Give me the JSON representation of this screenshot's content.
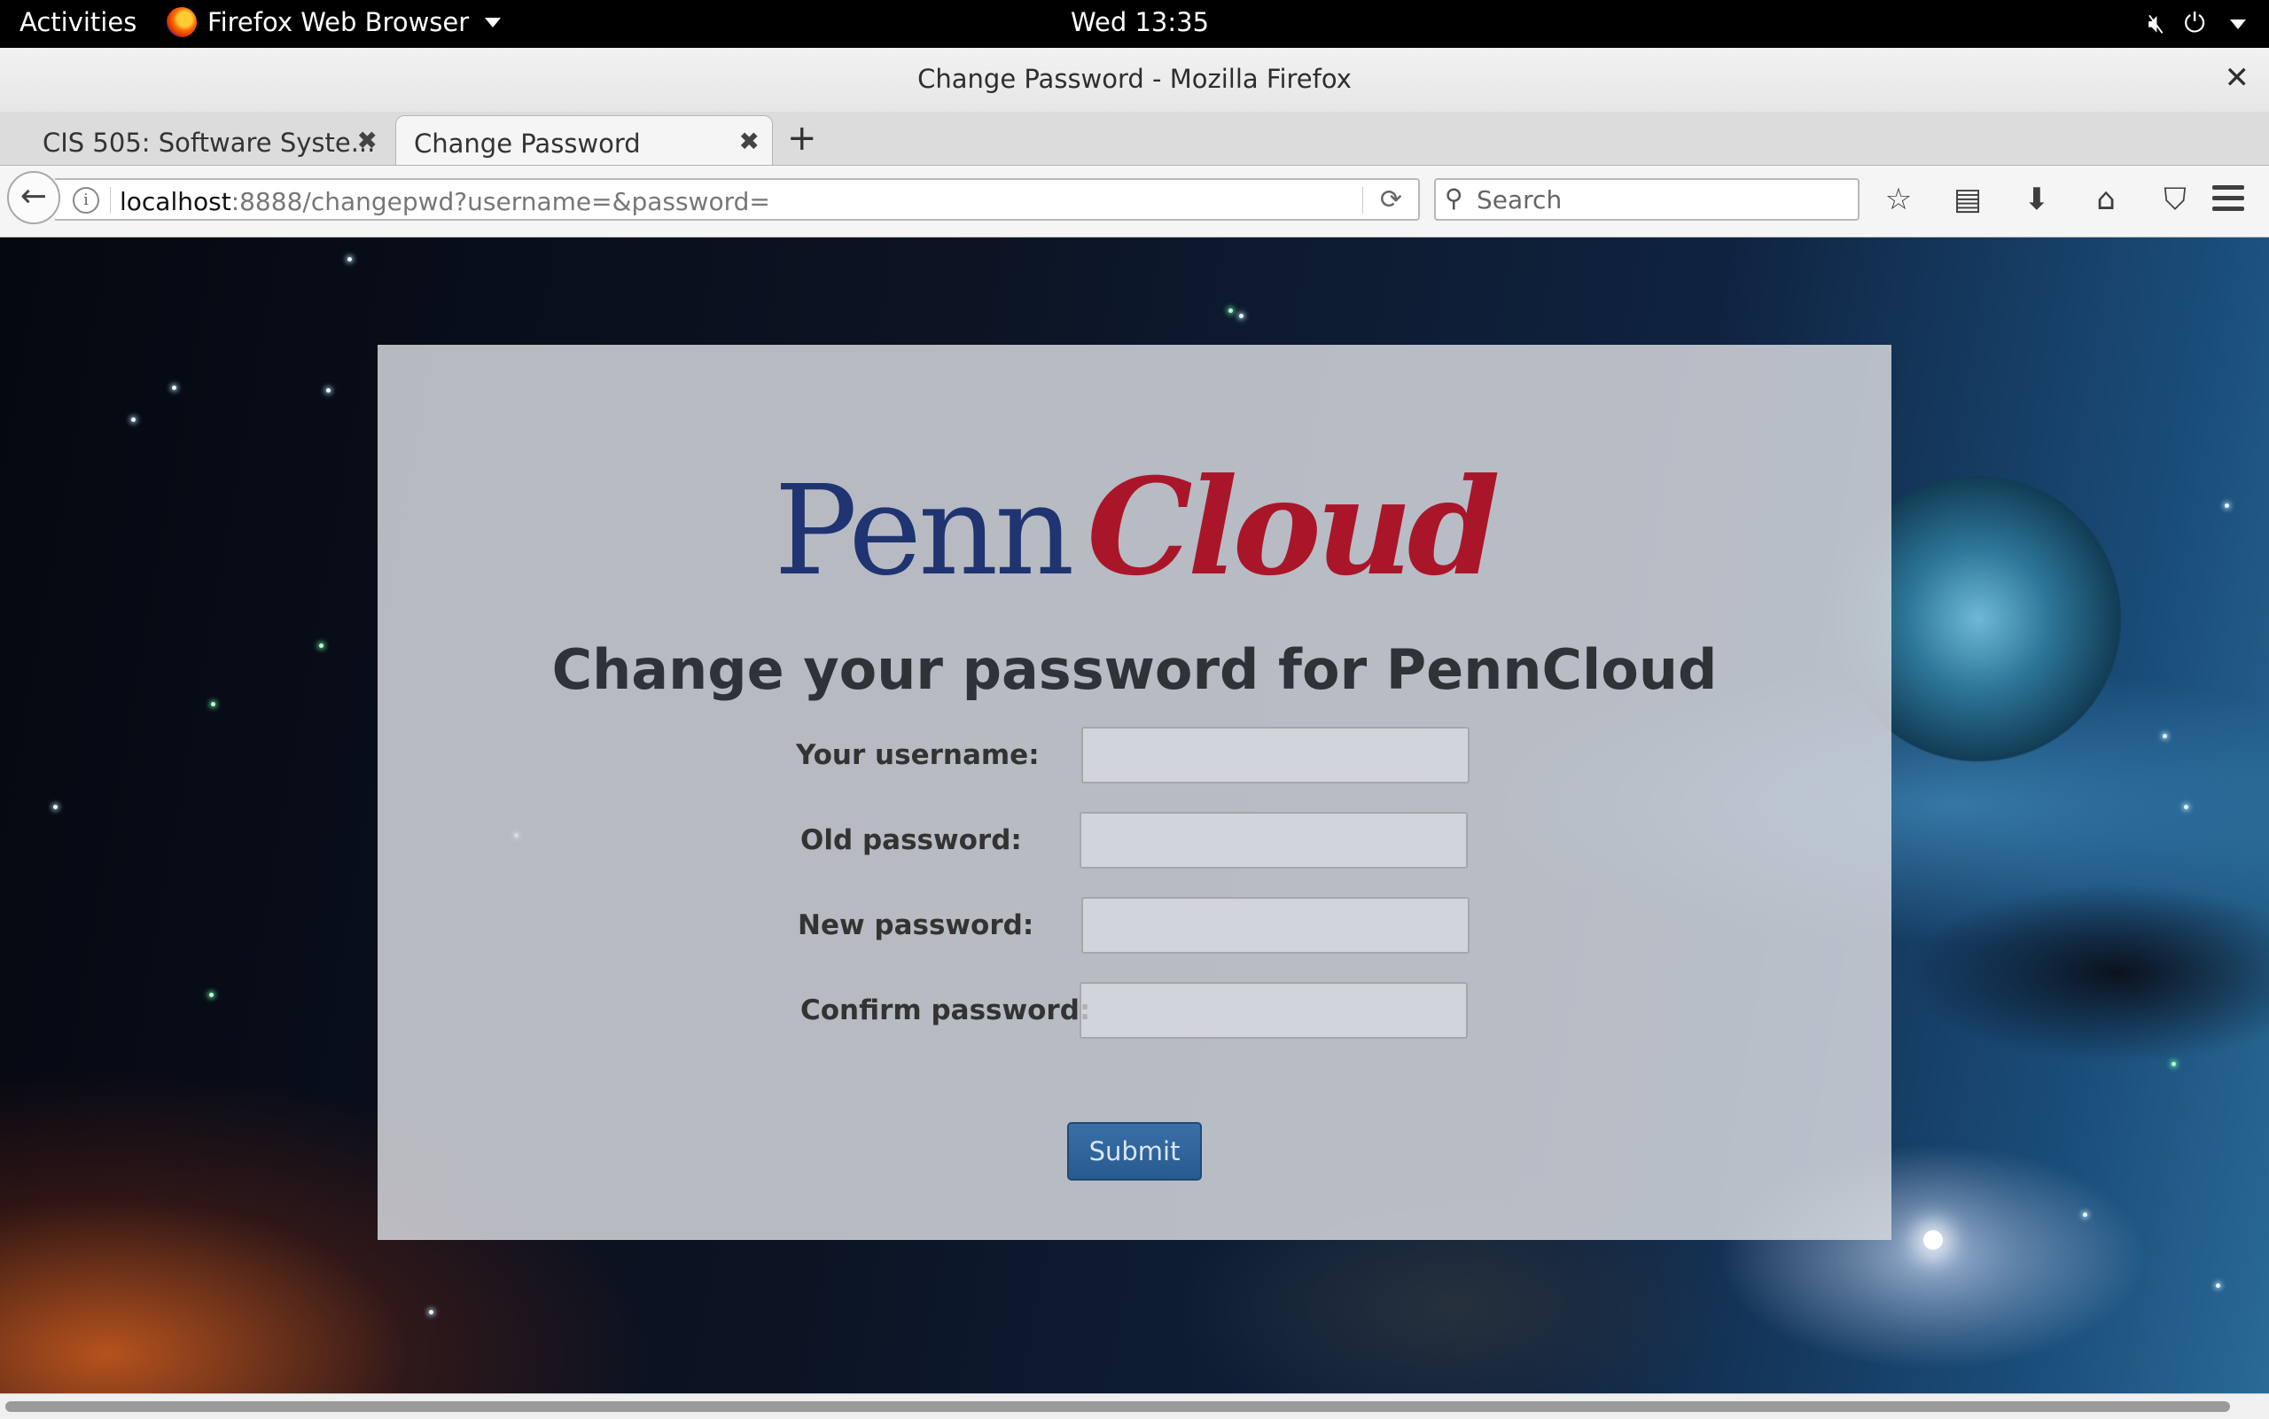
{
  "system_bar": {
    "activities": "Activities",
    "app_name": "Firefox Web Browser",
    "clock": "Wed 13:35",
    "icons": [
      "volume-muted-icon",
      "power-icon",
      "chevron-down-icon"
    ]
  },
  "window": {
    "title": "Change Password - Mozilla Firefox"
  },
  "tabs": [
    {
      "label": "CIS 505: Software Syste...",
      "active": false
    },
    {
      "label": "Change Password",
      "active": true
    }
  ],
  "navbar": {
    "url_host": "localhost",
    "url_rest": ":8888/changepwd?username=&password=",
    "search_placeholder": "Search",
    "icons": [
      "bookmark-star-icon",
      "reading-list-icon",
      "download-icon",
      "home-icon",
      "pocket-icon",
      "menu-icon"
    ]
  },
  "page": {
    "logo_penn": "Penn",
    "logo_cloud": "Cloud",
    "heading": "Change your password for PennCloud",
    "form": {
      "username_label": "Your username:",
      "old_password_label": "Old password:",
      "new_password_label": "New password:",
      "confirm_password_label": "Confirm password:",
      "username_value": "",
      "old_password_value": "",
      "new_password_value": "",
      "confirm_password_value": "",
      "submit_label": "Submit"
    },
    "colors": {
      "penn_blue": "#1f3470",
      "cloud_red": "#a9162a",
      "button_blue": "#285a8e"
    }
  }
}
